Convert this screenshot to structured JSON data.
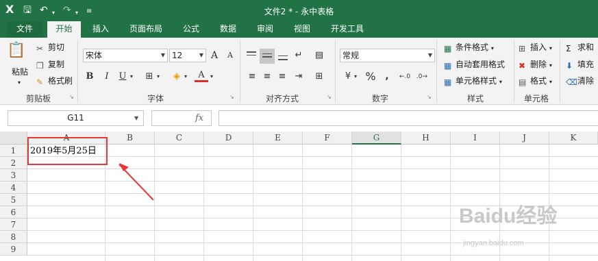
{
  "title_bar": {
    "title": "文件2 * - 永中表格"
  },
  "tabs": [
    "文件",
    "开始",
    "插入",
    "页面布局",
    "公式",
    "数据",
    "审阅",
    "视图",
    "开发工具"
  ],
  "active_tab": "开始",
  "clipboard": {
    "paste": "粘贴",
    "cut": "剪切",
    "copy": "复制",
    "format_painter": "格式刷",
    "group": "剪贴板"
  },
  "font": {
    "name": "宋体",
    "size": "12",
    "bold": "B",
    "italic": "I",
    "underline": "U",
    "grow": "A",
    "shrink": "A",
    "color_a": "A",
    "group": "字体"
  },
  "alignment": {
    "group": "对齐方式"
  },
  "number": {
    "format": "常规",
    "percent": "%",
    "comma": ",",
    "currency": "¥",
    "group": "数字"
  },
  "styles": {
    "conditional": "条件格式",
    "autoformat": "自动套用格式",
    "cell_style": "单元格样式",
    "group": "样式"
  },
  "cells": {
    "insert": "插入",
    "delete": "删除",
    "format": "格式",
    "group": "单元格"
  },
  "editing": {
    "sum": "求和",
    "fill": "填充",
    "clear": "清除"
  },
  "namebox": "G11",
  "fx": "fx",
  "columns": [
    "A",
    "B",
    "C",
    "D",
    "E",
    "F",
    "G",
    "H",
    "I",
    "J",
    "K"
  ],
  "selected_column": "G",
  "rows": [
    "1",
    "2",
    "3",
    "4",
    "5",
    "6",
    "7",
    "8",
    "9"
  ],
  "cells_data": {
    "A1": "2019年5月25日"
  },
  "watermark": {
    "brand": "Baidu经验",
    "url": "jingyan.baidu.com"
  },
  "colors": {
    "accent": "#217346",
    "annotation": "#e53935"
  }
}
